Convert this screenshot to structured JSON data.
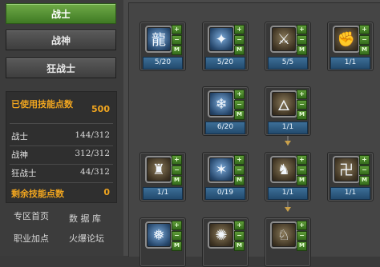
{
  "classes": [
    {
      "label": "战士",
      "active": true
    },
    {
      "label": "战神",
      "active": false
    },
    {
      "label": "狂战士",
      "active": false
    }
  ],
  "stats": {
    "used_label": "已使用技能点数",
    "used_value": "500",
    "rows": [
      {
        "label": "战士",
        "value": "144/312"
      },
      {
        "label": "战神",
        "value": "312/312"
      },
      {
        "label": "狂战士",
        "value": "44/312"
      }
    ],
    "remain_label": "剩余技能点数",
    "remain_value": "0"
  },
  "links": {
    "zone_home": "专区首页",
    "database": "数 据 库",
    "job_points": "职业加点",
    "forum": "火爆论坛"
  },
  "skill_buttons": {
    "plus": "+",
    "minus": "−",
    "max": "M"
  },
  "skills": [
    {
      "icon": "dragon-skill-icon",
      "glyph": "龍",
      "level": "5/20"
    },
    {
      "icon": "wing-strike-icon",
      "glyph": "✦",
      "level": "5/20"
    },
    {
      "icon": "warrior-stance-icon",
      "glyph": "⚔",
      "level": "5/5"
    },
    {
      "icon": "fist-icon",
      "glyph": "✊",
      "level": "1/1"
    },
    {
      "icon": "ice-spike-icon",
      "glyph": "❄",
      "level": "6/20"
    },
    {
      "icon": "bird-icon",
      "glyph": "🜂",
      "level": "1/1"
    },
    {
      "icon": "armor-icon",
      "glyph": "♜",
      "level": "1/1"
    },
    {
      "icon": "blade-storm-icon",
      "glyph": "✶",
      "level": "0/19"
    },
    {
      "icon": "beast-icon",
      "glyph": "♞",
      "level": "1/1"
    },
    {
      "icon": "rune-icon",
      "glyph": "卍",
      "level": "1/1"
    },
    {
      "icon": "frost-icon",
      "glyph": "❅",
      "level": ""
    },
    {
      "icon": "spin-icon",
      "glyph": "✺",
      "level": ""
    },
    {
      "icon": "fox-icon",
      "glyph": "♘",
      "level": ""
    }
  ]
}
